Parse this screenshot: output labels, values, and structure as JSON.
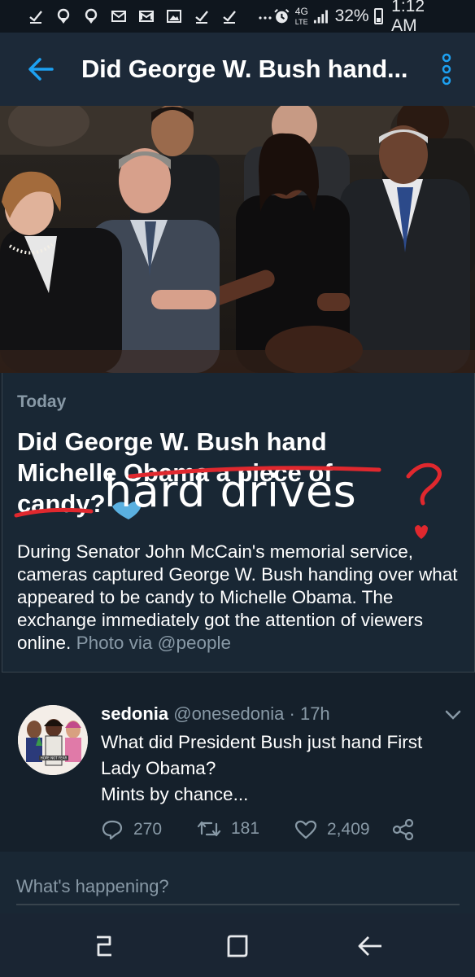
{
  "status_bar": {
    "network": "4G",
    "network_sub": "LTE",
    "battery": "32%",
    "time": "1:12 AM"
  },
  "app_bar": {
    "title": "Did George W. Bush hand..."
  },
  "card": {
    "label": "Today",
    "headline_line1": "Did George W. Bush hand",
    "headline_line2_a": "Michelle O",
    "headline_line2_b": "bama a piece of",
    "headline_line3": "candy?",
    "handwritten_annotation": "hard drives",
    "description": "During Senator John McCain's memorial service, cameras captured George W. Bush handing over what appeared to be candy to Michelle Obama. The exchange immediately got the attention of viewers online.",
    "credit": "Photo via @people"
  },
  "tweet": {
    "name": "sedonia",
    "handle": "@onesedonia",
    "separator": "·",
    "time": "17h",
    "text_lines": [
      "What did President Bush just hand First",
      "Lady Obama?",
      "Mints by chance..."
    ],
    "avatar_caption": "HOPE NOT FEAR",
    "replies": "270",
    "retweets": "181",
    "likes": "2,409"
  },
  "compose": {
    "placeholder": "What's happening?"
  },
  "colors": {
    "background": "#15202b",
    "card": "#192734",
    "accent": "#1da1f2",
    "muted": "#8899a6",
    "annotation_red": "#e0282e"
  },
  "icons": {
    "back": "arrow-left-icon",
    "more": "more-vertical-icon",
    "reply": "comment-icon",
    "retweet": "retweet-icon",
    "like": "heart-icon",
    "share": "share-icon",
    "caret": "chevron-down-icon"
  }
}
